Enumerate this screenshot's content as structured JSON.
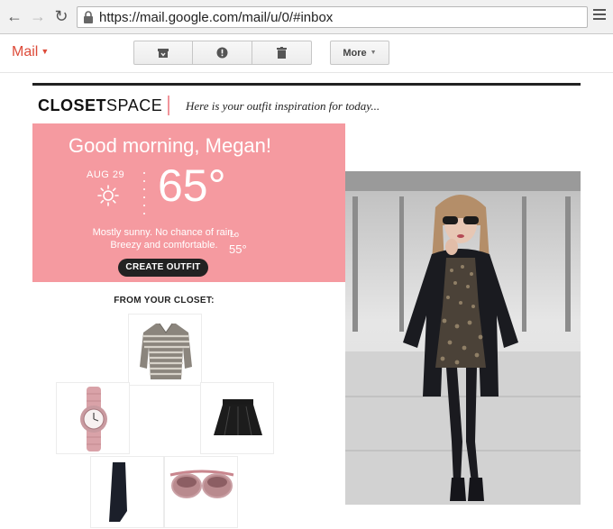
{
  "browser": {
    "url": "https://mail.google.com/mail/u/0/#inbox",
    "icons": [
      "back-icon",
      "forward-icon",
      "reload-icon",
      "lock-icon",
      "menu-icon"
    ]
  },
  "mail": {
    "label": "Mail",
    "toolbar": {
      "archive_icon": "archive-icon",
      "spam_icon": "report-spam-icon",
      "delete_icon": "trash-icon",
      "more_label": "More"
    }
  },
  "email": {
    "brand_bold": "CLOSET",
    "brand_rest": "SPACE",
    "tagline": "Here is your outfit inspiration for today...",
    "greeting": "Good morning, Megan!",
    "weather": {
      "date": "AUG 29",
      "icon": "sun-icon",
      "temp": "65°",
      "lo_label": "Lo",
      "lo": "55°",
      "forecast_line1": "Mostly sunny. No chance of rain.",
      "forecast_line2": "Breezy and comfortable."
    },
    "cta": "CREATE OUTFIT",
    "closet_title": "FROM YOUR CLOSET:",
    "closet_items": [
      "shirt",
      "watch",
      "skirt",
      "boots",
      "sunglasses"
    ]
  },
  "colors": {
    "pink": "#f59aa0",
    "mail_red": "#dd4b39",
    "dark": "#222222"
  }
}
